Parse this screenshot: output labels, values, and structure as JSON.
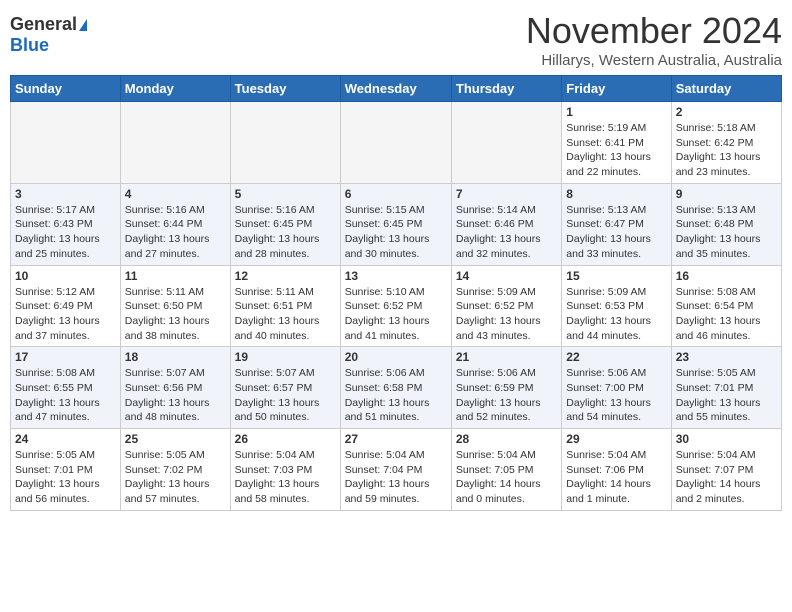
{
  "header": {
    "logo": {
      "general": "General",
      "blue": "Blue"
    },
    "title": "November 2024",
    "subtitle": "Hillarys, Western Australia, Australia"
  },
  "weekdays": [
    "Sunday",
    "Monday",
    "Tuesday",
    "Wednesday",
    "Thursday",
    "Friday",
    "Saturday"
  ],
  "weeks": [
    [
      {
        "day": "",
        "empty": true
      },
      {
        "day": "",
        "empty": true
      },
      {
        "day": "",
        "empty": true
      },
      {
        "day": "",
        "empty": true
      },
      {
        "day": "",
        "empty": true
      },
      {
        "day": "1",
        "sunrise": "5:19 AM",
        "sunset": "6:41 PM",
        "daylight": "13 hours and 22 minutes."
      },
      {
        "day": "2",
        "sunrise": "5:18 AM",
        "sunset": "6:42 PM",
        "daylight": "13 hours and 23 minutes."
      }
    ],
    [
      {
        "day": "3",
        "sunrise": "5:17 AM",
        "sunset": "6:43 PM",
        "daylight": "13 hours and 25 minutes."
      },
      {
        "day": "4",
        "sunrise": "5:16 AM",
        "sunset": "6:44 PM",
        "daylight": "13 hours and 27 minutes."
      },
      {
        "day": "5",
        "sunrise": "5:16 AM",
        "sunset": "6:45 PM",
        "daylight": "13 hours and 28 minutes."
      },
      {
        "day": "6",
        "sunrise": "5:15 AM",
        "sunset": "6:45 PM",
        "daylight": "13 hours and 30 minutes."
      },
      {
        "day": "7",
        "sunrise": "5:14 AM",
        "sunset": "6:46 PM",
        "daylight": "13 hours and 32 minutes."
      },
      {
        "day": "8",
        "sunrise": "5:13 AM",
        "sunset": "6:47 PM",
        "daylight": "13 hours and 33 minutes."
      },
      {
        "day": "9",
        "sunrise": "5:13 AM",
        "sunset": "6:48 PM",
        "daylight": "13 hours and 35 minutes."
      }
    ],
    [
      {
        "day": "10",
        "sunrise": "5:12 AM",
        "sunset": "6:49 PM",
        "daylight": "13 hours and 37 minutes."
      },
      {
        "day": "11",
        "sunrise": "5:11 AM",
        "sunset": "6:50 PM",
        "daylight": "13 hours and 38 minutes."
      },
      {
        "day": "12",
        "sunrise": "5:11 AM",
        "sunset": "6:51 PM",
        "daylight": "13 hours and 40 minutes."
      },
      {
        "day": "13",
        "sunrise": "5:10 AM",
        "sunset": "6:52 PM",
        "daylight": "13 hours and 41 minutes."
      },
      {
        "day": "14",
        "sunrise": "5:09 AM",
        "sunset": "6:52 PM",
        "daylight": "13 hours and 43 minutes."
      },
      {
        "day": "15",
        "sunrise": "5:09 AM",
        "sunset": "6:53 PM",
        "daylight": "13 hours and 44 minutes."
      },
      {
        "day": "16",
        "sunrise": "5:08 AM",
        "sunset": "6:54 PM",
        "daylight": "13 hours and 46 minutes."
      }
    ],
    [
      {
        "day": "17",
        "sunrise": "5:08 AM",
        "sunset": "6:55 PM",
        "daylight": "13 hours and 47 minutes."
      },
      {
        "day": "18",
        "sunrise": "5:07 AM",
        "sunset": "6:56 PM",
        "daylight": "13 hours and 48 minutes."
      },
      {
        "day": "19",
        "sunrise": "5:07 AM",
        "sunset": "6:57 PM",
        "daylight": "13 hours and 50 minutes."
      },
      {
        "day": "20",
        "sunrise": "5:06 AM",
        "sunset": "6:58 PM",
        "daylight": "13 hours and 51 minutes."
      },
      {
        "day": "21",
        "sunrise": "5:06 AM",
        "sunset": "6:59 PM",
        "daylight": "13 hours and 52 minutes."
      },
      {
        "day": "22",
        "sunrise": "5:06 AM",
        "sunset": "7:00 PM",
        "daylight": "13 hours and 54 minutes."
      },
      {
        "day": "23",
        "sunrise": "5:05 AM",
        "sunset": "7:01 PM",
        "daylight": "13 hours and 55 minutes."
      }
    ],
    [
      {
        "day": "24",
        "sunrise": "5:05 AM",
        "sunset": "7:01 PM",
        "daylight": "13 hours and 56 minutes."
      },
      {
        "day": "25",
        "sunrise": "5:05 AM",
        "sunset": "7:02 PM",
        "daylight": "13 hours and 57 minutes."
      },
      {
        "day": "26",
        "sunrise": "5:04 AM",
        "sunset": "7:03 PM",
        "daylight": "13 hours and 58 minutes."
      },
      {
        "day": "27",
        "sunrise": "5:04 AM",
        "sunset": "7:04 PM",
        "daylight": "13 hours and 59 minutes."
      },
      {
        "day": "28",
        "sunrise": "5:04 AM",
        "sunset": "7:05 PM",
        "daylight": "14 hours and 0 minutes."
      },
      {
        "day": "29",
        "sunrise": "5:04 AM",
        "sunset": "7:06 PM",
        "daylight": "14 hours and 1 minute."
      },
      {
        "day": "30",
        "sunrise": "5:04 AM",
        "sunset": "7:07 PM",
        "daylight": "14 hours and 2 minutes."
      }
    ]
  ]
}
